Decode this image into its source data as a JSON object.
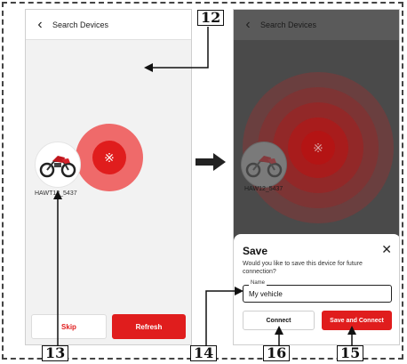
{
  "left_screen": {
    "header_title": "Search Devices",
    "device_label": "HAWT12_5437",
    "buttons": {
      "skip": "Skip",
      "refresh": "Refresh"
    }
  },
  "right_screen": {
    "header_title": "Search Devices",
    "device_label": "HAW12_5437",
    "modal": {
      "title": "Save",
      "text": "Would you like to save this device for future connection?",
      "field_label": "Name",
      "field_value": "My vehicle",
      "connect": "Connect",
      "save_connect": "Save and Connect"
    }
  },
  "callouts": {
    "c12": "12",
    "c13": "13",
    "c14": "14",
    "c15": "15",
    "c16": "16"
  },
  "colors": {
    "accent": "#e01d1d",
    "overlay": "#4a4a4a"
  },
  "icons": [
    "back-icon",
    "bluetooth-icon",
    "close-icon",
    "motorcycle-icon"
  ]
}
